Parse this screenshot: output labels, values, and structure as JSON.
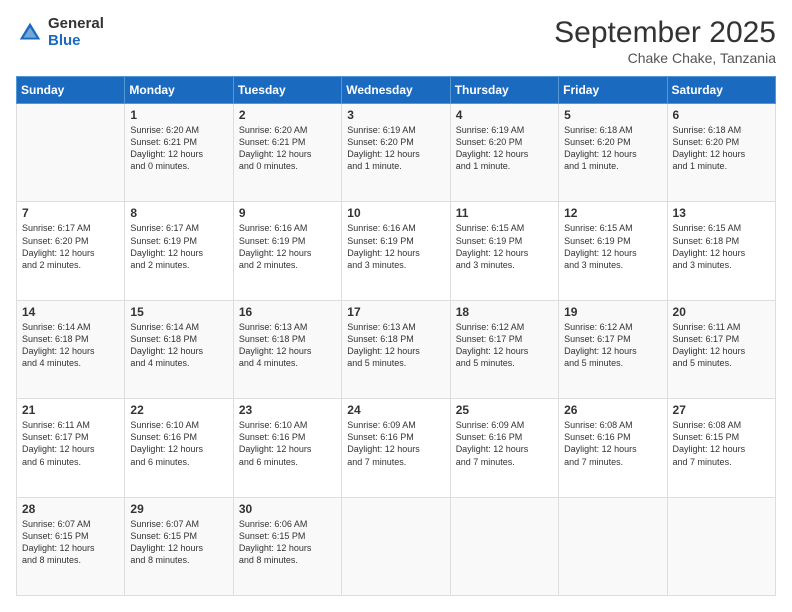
{
  "header": {
    "logo_general": "General",
    "logo_blue": "Blue",
    "main_title": "September 2025",
    "sub_title": "Chake Chake, Tanzania"
  },
  "calendar": {
    "days_of_week": [
      "Sunday",
      "Monday",
      "Tuesday",
      "Wednesday",
      "Thursday",
      "Friday",
      "Saturday"
    ],
    "weeks": [
      [
        {
          "day": "",
          "info": ""
        },
        {
          "day": "1",
          "info": "Sunrise: 6:20 AM\nSunset: 6:21 PM\nDaylight: 12 hours\nand 0 minutes."
        },
        {
          "day": "2",
          "info": "Sunrise: 6:20 AM\nSunset: 6:21 PM\nDaylight: 12 hours\nand 0 minutes."
        },
        {
          "day": "3",
          "info": "Sunrise: 6:19 AM\nSunset: 6:20 PM\nDaylight: 12 hours\nand 1 minute."
        },
        {
          "day": "4",
          "info": "Sunrise: 6:19 AM\nSunset: 6:20 PM\nDaylight: 12 hours\nand 1 minute."
        },
        {
          "day": "5",
          "info": "Sunrise: 6:18 AM\nSunset: 6:20 PM\nDaylight: 12 hours\nand 1 minute."
        },
        {
          "day": "6",
          "info": "Sunrise: 6:18 AM\nSunset: 6:20 PM\nDaylight: 12 hours\nand 1 minute."
        }
      ],
      [
        {
          "day": "7",
          "info": "Sunrise: 6:17 AM\nSunset: 6:20 PM\nDaylight: 12 hours\nand 2 minutes."
        },
        {
          "day": "8",
          "info": "Sunrise: 6:17 AM\nSunset: 6:19 PM\nDaylight: 12 hours\nand 2 minutes."
        },
        {
          "day": "9",
          "info": "Sunrise: 6:16 AM\nSunset: 6:19 PM\nDaylight: 12 hours\nand 2 minutes."
        },
        {
          "day": "10",
          "info": "Sunrise: 6:16 AM\nSunset: 6:19 PM\nDaylight: 12 hours\nand 3 minutes."
        },
        {
          "day": "11",
          "info": "Sunrise: 6:15 AM\nSunset: 6:19 PM\nDaylight: 12 hours\nand 3 minutes."
        },
        {
          "day": "12",
          "info": "Sunrise: 6:15 AM\nSunset: 6:19 PM\nDaylight: 12 hours\nand 3 minutes."
        },
        {
          "day": "13",
          "info": "Sunrise: 6:15 AM\nSunset: 6:18 PM\nDaylight: 12 hours\nand 3 minutes."
        }
      ],
      [
        {
          "day": "14",
          "info": "Sunrise: 6:14 AM\nSunset: 6:18 PM\nDaylight: 12 hours\nand 4 minutes."
        },
        {
          "day": "15",
          "info": "Sunrise: 6:14 AM\nSunset: 6:18 PM\nDaylight: 12 hours\nand 4 minutes."
        },
        {
          "day": "16",
          "info": "Sunrise: 6:13 AM\nSunset: 6:18 PM\nDaylight: 12 hours\nand 4 minutes."
        },
        {
          "day": "17",
          "info": "Sunrise: 6:13 AM\nSunset: 6:18 PM\nDaylight: 12 hours\nand 5 minutes."
        },
        {
          "day": "18",
          "info": "Sunrise: 6:12 AM\nSunset: 6:17 PM\nDaylight: 12 hours\nand 5 minutes."
        },
        {
          "day": "19",
          "info": "Sunrise: 6:12 AM\nSunset: 6:17 PM\nDaylight: 12 hours\nand 5 minutes."
        },
        {
          "day": "20",
          "info": "Sunrise: 6:11 AM\nSunset: 6:17 PM\nDaylight: 12 hours\nand 5 minutes."
        }
      ],
      [
        {
          "day": "21",
          "info": "Sunrise: 6:11 AM\nSunset: 6:17 PM\nDaylight: 12 hours\nand 6 minutes."
        },
        {
          "day": "22",
          "info": "Sunrise: 6:10 AM\nSunset: 6:16 PM\nDaylight: 12 hours\nand 6 minutes."
        },
        {
          "day": "23",
          "info": "Sunrise: 6:10 AM\nSunset: 6:16 PM\nDaylight: 12 hours\nand 6 minutes."
        },
        {
          "day": "24",
          "info": "Sunrise: 6:09 AM\nSunset: 6:16 PM\nDaylight: 12 hours\nand 7 minutes."
        },
        {
          "day": "25",
          "info": "Sunrise: 6:09 AM\nSunset: 6:16 PM\nDaylight: 12 hours\nand 7 minutes."
        },
        {
          "day": "26",
          "info": "Sunrise: 6:08 AM\nSunset: 6:16 PM\nDaylight: 12 hours\nand 7 minutes."
        },
        {
          "day": "27",
          "info": "Sunrise: 6:08 AM\nSunset: 6:15 PM\nDaylight: 12 hours\nand 7 minutes."
        }
      ],
      [
        {
          "day": "28",
          "info": "Sunrise: 6:07 AM\nSunset: 6:15 PM\nDaylight: 12 hours\nand 8 minutes."
        },
        {
          "day": "29",
          "info": "Sunrise: 6:07 AM\nSunset: 6:15 PM\nDaylight: 12 hours\nand 8 minutes."
        },
        {
          "day": "30",
          "info": "Sunrise: 6:06 AM\nSunset: 6:15 PM\nDaylight: 12 hours\nand 8 minutes."
        },
        {
          "day": "",
          "info": ""
        },
        {
          "day": "",
          "info": ""
        },
        {
          "day": "",
          "info": ""
        },
        {
          "day": "",
          "info": ""
        }
      ]
    ]
  }
}
